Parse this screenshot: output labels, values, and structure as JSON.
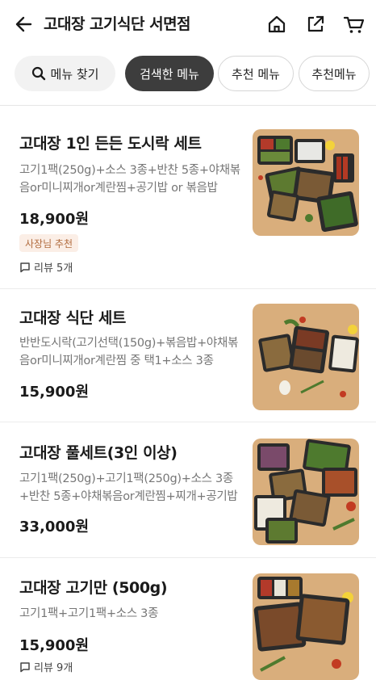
{
  "header": {
    "title": "고대장 고기식단 서면점",
    "back_icon": "arrow-left-icon",
    "home_icon": "home-icon",
    "share_icon": "share-icon",
    "cart_icon": "cart-icon"
  },
  "chips": [
    {
      "label": "메뉴 찾기",
      "icon": "search-icon"
    },
    {
      "label": "검색한 메뉴"
    },
    {
      "label": "추천 메뉴"
    },
    {
      "label": "추천메뉴"
    }
  ],
  "menu_items": [
    {
      "name": "고대장 1인 든든 도시락 세트",
      "description": "고기1팩(250g)+소스 3종+반찬 5종+야채볶음or미니찌개or계란찜+공기밥 or 볶음밥",
      "price": "18,900원",
      "badge": "사장님 추천",
      "review": "리뷰 5개"
    },
    {
      "name": "고대장 식단 세트",
      "description": "반반도시락(고기선택(150g)+볶음밥+야채볶음or미니찌개or계란찜 중 택1+소스 3종",
      "price": "15,900원"
    },
    {
      "name": "고대장 풀세트(3인 이상)",
      "description": "고기1팩(250g)+고기1팩(250g)+소스 3종+반찬 5종+야채볶음or계란찜+찌개+공기밥",
      "price": "33,000원"
    },
    {
      "name": "고대장 고기만 (500g)",
      "description": "고기1팩+고기1팩+소스 3종",
      "price": "15,900원",
      "review": "리뷰 9개"
    }
  ],
  "colors": {
    "active_chip": "#3d3d3d",
    "badge_bg": "#fbeee6",
    "badge_text": "#b06a3c",
    "photo_bg": "#d9ae7c"
  }
}
